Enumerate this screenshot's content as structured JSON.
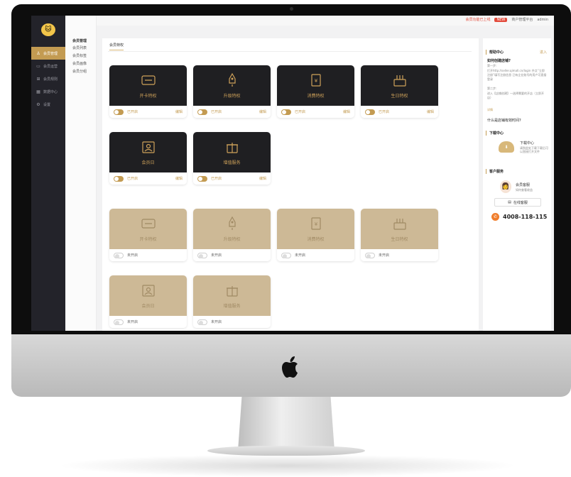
{
  "topbar": {
    "notice": "会员功能已上线",
    "badge": "NEW",
    "account": "商户管理平台",
    "user": "admin"
  },
  "sidebar": {
    "logo_icon": "cat-logo-icon",
    "items": [
      {
        "icon": "user-icon",
        "label": "会员管理",
        "active": true
      },
      {
        "icon": "monitor-icon",
        "label": "会员运营",
        "active": false
      },
      {
        "icon": "grid-icon",
        "label": "会员规则",
        "active": false
      },
      {
        "icon": "chart-icon",
        "label": "数据中心",
        "active": false
      },
      {
        "icon": "gear-icon",
        "label": "设置",
        "active": false
      }
    ]
  },
  "subnav": {
    "heading": "会员管理",
    "items": [
      "会员列表",
      "会员标签",
      "会员画像",
      "会员分组"
    ]
  },
  "main": {
    "tab": "会员特权"
  },
  "cards": [
    {
      "title": "开卡特权",
      "on": true,
      "state": "已开启",
      "edit": "编辑",
      "icon": "card-icon"
    },
    {
      "title": "升级特权",
      "on": true,
      "state": "已开启",
      "edit": "编辑",
      "icon": "rocket-icon"
    },
    {
      "title": "消费特权",
      "on": true,
      "state": "已开启",
      "edit": "编辑",
      "icon": "receipt-icon"
    },
    {
      "title": "生日特权",
      "on": true,
      "state": "已开启",
      "edit": "编辑",
      "icon": "cake-icon"
    },
    {
      "title": "会员日",
      "on": true,
      "state": "已开启",
      "edit": "编辑",
      "icon": "calendar-user-icon"
    },
    {
      "title": "增值服务",
      "on": true,
      "state": "已开启",
      "edit": "编辑",
      "icon": "gift-icon"
    },
    {
      "title": "开卡特权",
      "on": false,
      "state": "未开启",
      "edit": "",
      "icon": "card-icon"
    },
    {
      "title": "升级特权",
      "on": false,
      "state": "未开启",
      "edit": "",
      "icon": "rocket-icon"
    },
    {
      "title": "消费特权",
      "on": false,
      "state": "未开启",
      "edit": "",
      "icon": "receipt-icon"
    },
    {
      "title": "生日特权",
      "on": false,
      "state": "未开启",
      "edit": "",
      "icon": "cake-icon"
    },
    {
      "title": "会员日",
      "on": false,
      "state": "未开启",
      "edit": "",
      "icon": "calendar-user-icon"
    },
    {
      "title": "增值服务",
      "on": false,
      "state": "未开启",
      "edit": "",
      "icon": "gift-icon"
    }
  ],
  "right_panel": {
    "help": {
      "title": "帮助中心",
      "more": "进入",
      "q1": "如何创建店铺?",
      "a1": "第一步:",
      "a1_body": "打开http://seller.qimall.cn/login 并点“立即注册”填写注册信息 已有企业账号的用户可直接登录",
      "a2": "第二步:",
      "a2_body": "进入【店铺创建】—选择需要的开店（立即开店）",
      "detail": "详情",
      "q2": "什么是店铺有效时间?"
    },
    "download": {
      "title": "下载中心",
      "item_title": "下载中心",
      "item_sub": "请到此处下载下载后可以直接打开文件"
    },
    "service": {
      "title": "客户服务",
      "cs_title": "会员客服",
      "cs_sub": "如何查看收益",
      "chat": "在线客服",
      "phone": "4008-118-115"
    }
  }
}
